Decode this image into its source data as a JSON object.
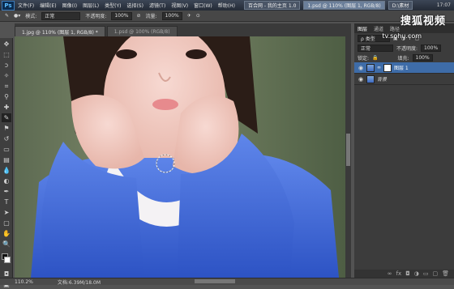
{
  "taskbar": {
    "app_logo": "Ps",
    "menu": [
      "文件(F)",
      "编辑(E)",
      "图像(I)",
      "图层(L)",
      "类型(Y)",
      "选择(S)",
      "滤镜(T)",
      "视图(V)",
      "窗口(W)",
      "帮助(H)"
    ],
    "tasks": [
      {
        "label": "百合网 - 我的主页 1.0",
        "active": false
      },
      {
        "label": "1.psd @ 110% (图层 1, RGB/8)",
        "active": true
      },
      {
        "label": "D:\\素材",
        "active": false
      }
    ],
    "clock": "17:07"
  },
  "options": {
    "mode_label": "模式:",
    "mode_value": "正常",
    "opacity_label": "不透明度:",
    "opacity_value": "100%",
    "flow_label": "流量:",
    "flow_value": "100%"
  },
  "doc": {
    "tabs": [
      {
        "label": "1.jpg @ 110% (图层 1, RGB/8) *",
        "active": true
      },
      {
        "label": "1.psd @ 100% (RGB/8)",
        "active": false
      }
    ]
  },
  "status": {
    "zoom": "110.2%",
    "doc_size": "文档:6.39M/18.0M"
  },
  "layers_panel": {
    "tabs": [
      "图层",
      "通道",
      "路径"
    ],
    "kind_label": "ρ 类型",
    "blend_mode": "正常",
    "opacity_label": "不透明度:",
    "opacity_value": "100%",
    "lock_label": "锁定:",
    "fill_label": "填充:",
    "fill_value": "100%",
    "layers": [
      {
        "name": "图层 1",
        "selected": true,
        "has_mask": true
      },
      {
        "name": "背景",
        "selected": false,
        "has_mask": false
      }
    ]
  },
  "watermark": {
    "brand": "搜狐视频",
    "url": "tv.sohu.com"
  },
  "colors": {
    "accent": "#3e6ca8",
    "panel_bg": "#3c3c3c",
    "workspace_bg": "#535353"
  }
}
